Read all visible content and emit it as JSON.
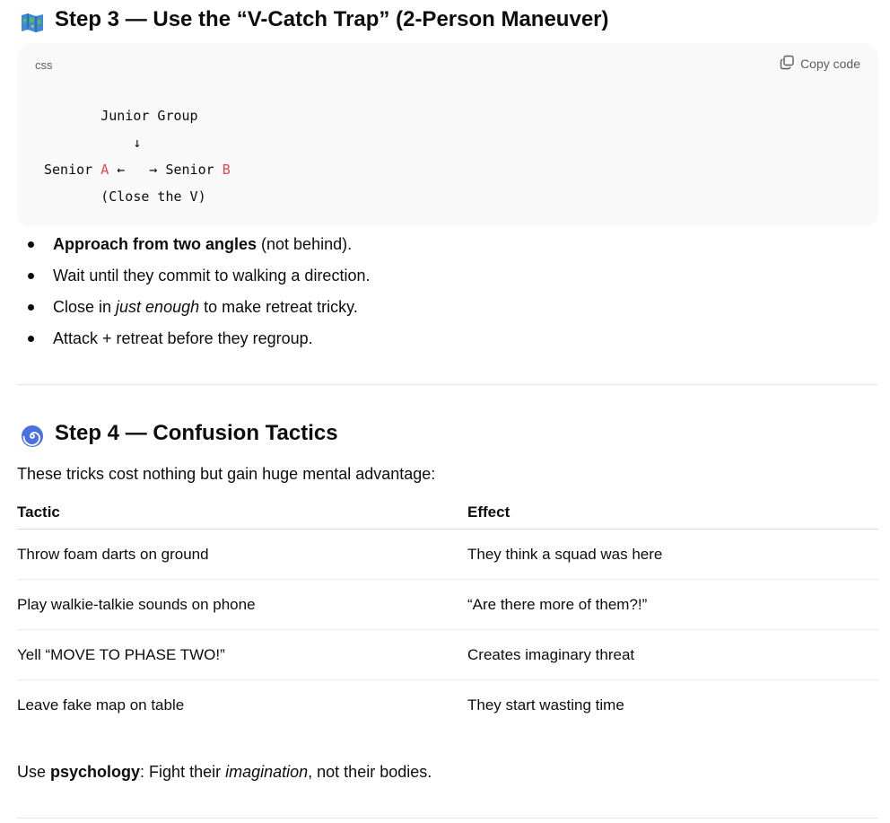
{
  "step3": {
    "icon": "map-icon",
    "title": "Step 3 — Use the “V-Catch Trap” (2-Person Maneuver)",
    "code": {
      "lang": "css",
      "copy_label": "Copy code",
      "lines": {
        "l1": "       Junior Group",
        "l2": "           ↓",
        "l3a": "Senior ",
        "l3b": "A",
        "l3c": " ←   → Senior ",
        "l3d": "B",
        "l4": "       (Close the V)"
      }
    },
    "bullets": {
      "b1_bold": "Approach from two angles",
      "b1_rest": " (not behind).",
      "b2": "Wait until they commit to walking a direction.",
      "b3_pre": "Close in ",
      "b3_em": "just enough",
      "b3_post": " to make retreat tricky.",
      "b4": "Attack + retreat before they regroup."
    }
  },
  "step4": {
    "icon": "spiral-icon",
    "title": "Step 4 — Confusion Tactics",
    "intro": "These tricks cost nothing but gain huge mental advantage:",
    "table": {
      "headers": [
        "Tactic",
        "Effect"
      ],
      "rows": [
        [
          "Throw foam darts on ground",
          "They think a squad was here"
        ],
        [
          "Play walkie-talkie sounds on phone",
          "“Are there more of them?!”"
        ],
        [
          "Yell “MOVE TO PHASE TWO!”",
          "Creates imaginary threat"
        ],
        [
          "Leave fake map on table",
          "They start wasting time"
        ]
      ]
    },
    "closing": {
      "pre": "Use ",
      "bold": "psychology",
      "mid": ": Fight their ",
      "em": "imagination",
      "post": ", not their bodies."
    }
  },
  "colors": {
    "accent_code": "#e5484d",
    "text": "#0d0d0d",
    "muted": "#5d5d5d"
  }
}
